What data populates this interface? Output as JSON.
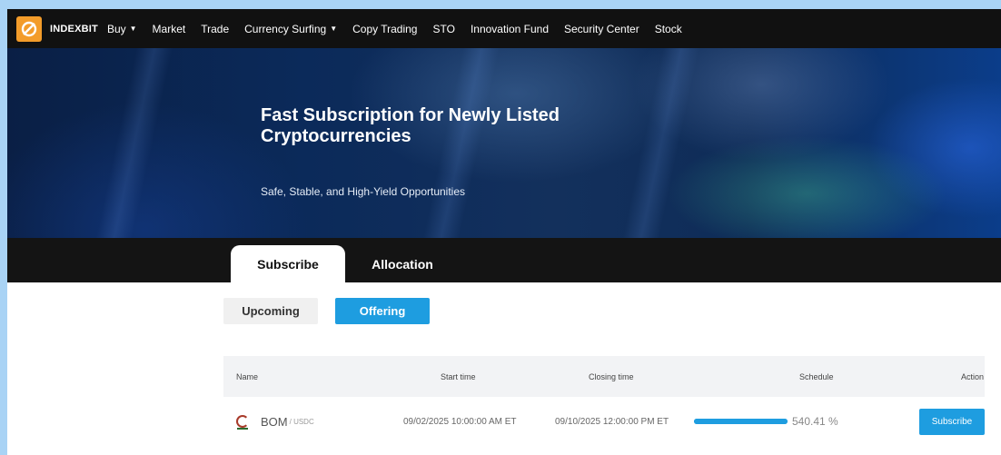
{
  "brand": {
    "name": "INDEXBIT",
    "accent": "#f39c2a"
  },
  "nav": {
    "items": [
      {
        "label": "Buy",
        "dropdown": true
      },
      {
        "label": "Market",
        "dropdown": false
      },
      {
        "label": "Trade",
        "dropdown": false
      },
      {
        "label": "Currency Surfing",
        "dropdown": true
      },
      {
        "label": "Copy Trading",
        "dropdown": false
      },
      {
        "label": "STO",
        "dropdown": false
      },
      {
        "label": "Innovation Fund",
        "dropdown": false
      },
      {
        "label": "Security Center",
        "dropdown": false
      },
      {
        "label": "Stock",
        "dropdown": false
      }
    ]
  },
  "hero": {
    "title": "Fast Subscription for Newly Listed Cryptocurrencies",
    "subtitle": "Safe, Stable, and High-Yield Opportunities"
  },
  "tabs": {
    "subscribe": "Subscribe",
    "allocation": "Allocation",
    "active": "subscribe"
  },
  "subtabs": {
    "upcoming": "Upcoming",
    "offering": "Offering",
    "active": "offering"
  },
  "table": {
    "headers": {
      "name": "Name",
      "start": "Start time",
      "closing": "Closing time",
      "schedule": "Schedule",
      "action": "Action"
    },
    "rows": [
      {
        "coin": "BOM",
        "quote": "/ USDC",
        "start": "09/02/2025 10:00:00 AM ET",
        "closing": "09/10/2025 12:00:00 PM ET",
        "schedule_text": "540.41 %",
        "progress": 1.0,
        "action": "Subscribe",
        "icon": "coin-icon"
      }
    ]
  },
  "colors": {
    "primary": "#1e9de0",
    "nav_bg": "#111111"
  }
}
